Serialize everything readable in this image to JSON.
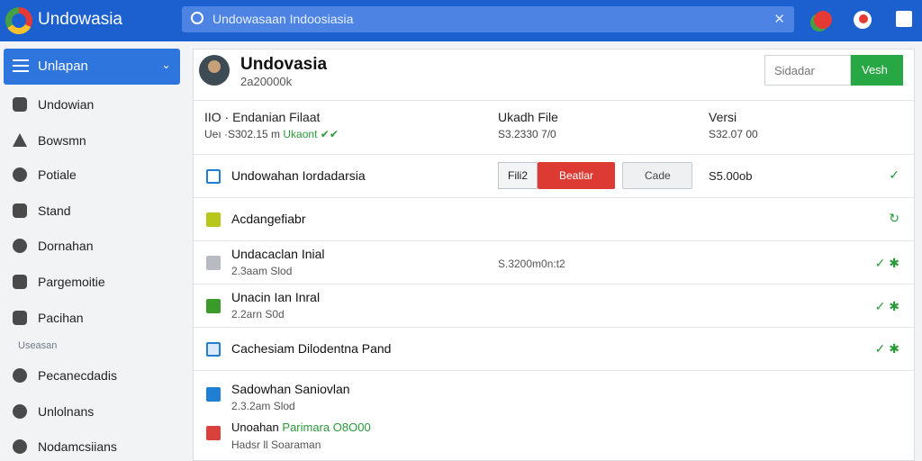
{
  "app": {
    "title": "Undowasia",
    "search_text": "Undowasaan Indoosiasia",
    "search_clear": "✕"
  },
  "sidebar": {
    "header_label": "Unlapan",
    "items": [
      {
        "label": "Undowian",
        "icon": "bag-icon"
      },
      {
        "label": "Bowsmn",
        "icon": "pen-icon"
      },
      {
        "label": "Potiale",
        "icon": "search-icon"
      },
      {
        "label": "Stand",
        "icon": "printer-icon"
      },
      {
        "label": "Dornahan",
        "icon": "user-icon"
      },
      {
        "label": "Pargemoitie",
        "icon": "grid-icon"
      },
      {
        "label": "Pacihan",
        "icon": "brush-icon"
      }
    ],
    "section_label": "Useasan",
    "items2": [
      {
        "label": "Pecanecdadis",
        "icon": "gear-icon"
      },
      {
        "label": "Unlolnans",
        "icon": "box-icon"
      },
      {
        "label": "Nodamcsiians",
        "icon": "user-icon"
      }
    ]
  },
  "profile": {
    "name": "Undovasia",
    "sub": "2a20000k"
  },
  "actions": {
    "search_label": "Sidadar",
    "primary_label": "Vesh"
  },
  "header": {
    "col1_title": "IIO · Endanian Filaat",
    "col1_sub": "Ueı ·S302.15 m",
    "col1_status": "Ukaont",
    "col2_title": "Ukadh File",
    "col2_sub": "S3.2330 7/0",
    "col3_title": "Versi",
    "col3_sub": "S32.07 00"
  },
  "rows": [
    {
      "title": "Undowahan Iordadarsia",
      "file_label": "Fili2",
      "red_label": "Beatlar",
      "gray_label": "Cade",
      "price": "S5.00ob",
      "status": "✓"
    },
    {
      "title": "Acdangefiabr",
      "status": "↻"
    },
    {
      "title": "Undacaclan Inial",
      "sub": "2.3aam  Slod",
      "mid": "S.3200m0n:t2",
      "status": "✓ ✱"
    },
    {
      "title": "Unacin Ian Inral",
      "sub": "2.2arn  S0d",
      "status": "✓ ✱"
    },
    {
      "title": "Cachesiam Dilodentna Pand",
      "status": "✓ ✱"
    },
    {
      "title": "Sadowhan Saniovlan",
      "sub": "2.3.2am  Slod"
    },
    {
      "title": "Unoahan",
      "title_green": "Parimara O8O00",
      "sub": "Hadsr ll Soaraman"
    }
  ],
  "colors": {
    "topbar": "#1c5fcf",
    "accent": "#2f75de",
    "green": "#28a745",
    "red": "#dc3a33"
  }
}
